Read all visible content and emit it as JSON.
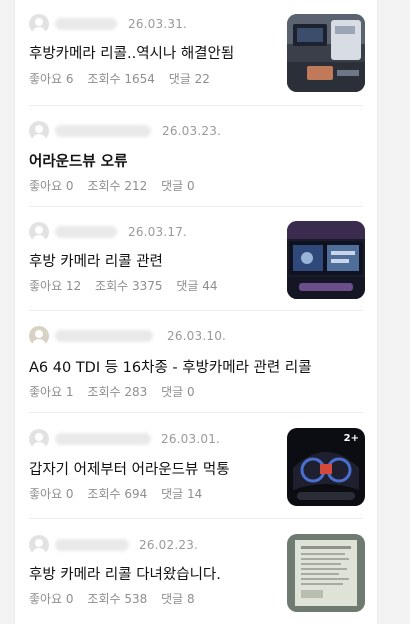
{
  "posts": [
    {
      "date": "26.03.31.",
      "title": "후방카메라 리콜..역시나 해결안됨",
      "likes": "좋아요 6",
      "views": "조회수 1654",
      "comments": "댓글 22"
    },
    {
      "date": "26.03.23.",
      "title": "어라운드뷰 오류",
      "likes": "좋아요 0",
      "views": "조회수 212",
      "comments": "댓글 0"
    },
    {
      "date": "26.03.17.",
      "title": "후방 카메라 리콜 관련",
      "likes": "좋아요 12",
      "views": "조회수 3375",
      "comments": "댓글 44"
    },
    {
      "date": "26.03.10.",
      "title": "A6 40 TDI 등 16차종 - 후방카메라 관련 리콜",
      "likes": "좋아요 1",
      "views": "조회수 283",
      "comments": "댓글 0"
    },
    {
      "date": "26.03.01.",
      "title": "갑자기 어제부터 어라운드뷰 먹통",
      "likes": "좋아요 0",
      "views": "조회수 694",
      "comments": "댓글 14",
      "badge": "2+"
    },
    {
      "date": "26.02.23.",
      "title": "후방 카메라 리콜 다녀왔습니다.",
      "likes": "좋아요 0",
      "views": "조회수 538",
      "comments": "댓글 8"
    }
  ],
  "icons": {
    "avatar": "avatar-icon",
    "thumbnail": "photo-thumbnail"
  }
}
